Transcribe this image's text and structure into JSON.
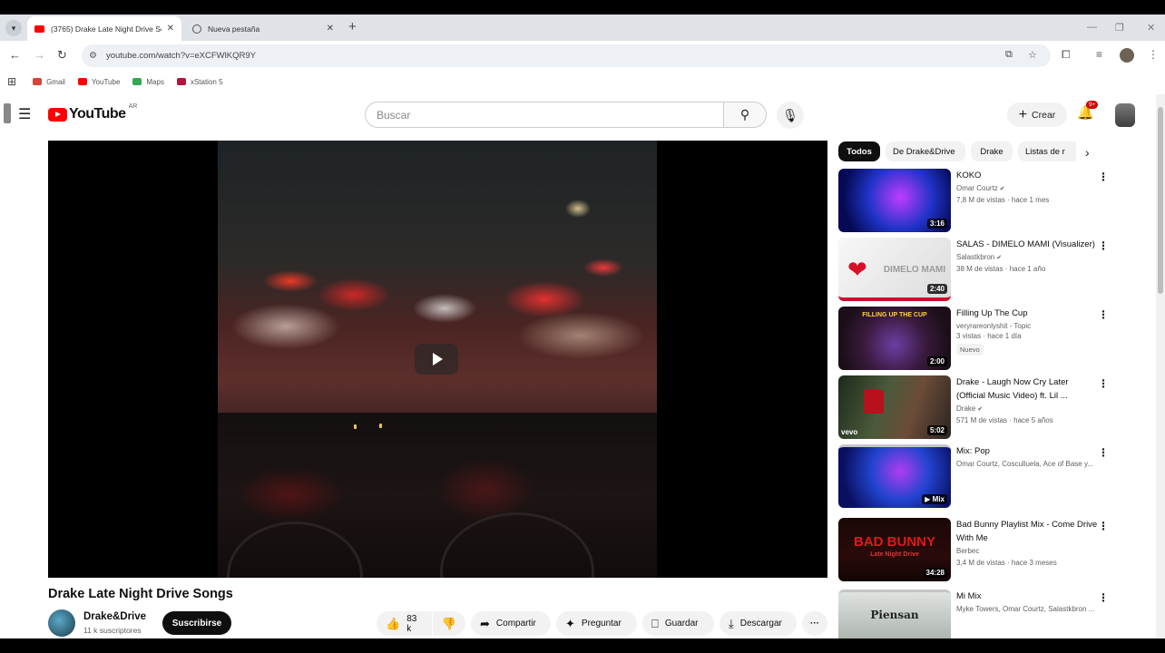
{
  "browser": {
    "tabs": [
      {
        "title": "(3765) Drake Late Night Drive Son",
        "active": true
      },
      {
        "title": "Nueva pestaña",
        "active": false
      }
    ],
    "url": "youtube.com/watch?v=eXCFWlKQR9Y",
    "bookmarks": [
      "Gmail",
      "YouTube",
      "Maps",
      "xStation 5"
    ]
  },
  "header": {
    "logo_text": "YouTube",
    "logo_country": "AR",
    "search_placeholder": "Buscar",
    "create_label": "Crear",
    "notif_badge": "9+"
  },
  "video": {
    "title": "Drake Late Night Drive Songs",
    "channel": "Drake&Drive",
    "subscribers": "11 k suscriptores",
    "subscribe_label": "Suscribirse",
    "likes": "83 k",
    "actions": {
      "share": "Compartir",
      "ask": "Preguntar",
      "save": "Guardar",
      "download": "Descargar"
    }
  },
  "sidebar": {
    "chips": [
      "Todos",
      "De Drake&Drive",
      "Drake",
      "Listas de r"
    ],
    "recommendations": [
      {
        "title": "KOKO",
        "channel": "Omar Courtz",
        "verified": true,
        "meta": "7,8 M de vistas · hace 1 mes",
        "duration": "3:16",
        "badge": ""
      },
      {
        "title": "SALAS - DIMELO MAMI (Visualizer)",
        "channel": "Salastkbron",
        "verified": true,
        "meta": "38 M de vistas · hace 1 año",
        "duration": "2:40",
        "badge": ""
      },
      {
        "title": "Filling Up The Cup",
        "channel": "veryrareonlyshit - Topic",
        "verified": false,
        "meta": "3 vistas · hace 1 día",
        "duration": "2:00",
        "badge": "Nuevo"
      },
      {
        "title": "Drake - Laugh Now Cry Later (Official Music Video) ft. Lil ...",
        "channel": "Drake",
        "verified": true,
        "meta": "571 M de vistas · hace 5 años",
        "duration": "5:02",
        "badge": ""
      },
      {
        "title": "Mix: Pop",
        "channel": "Omar Courtz, Cosculluela, Ace of Base y...",
        "verified": false,
        "meta": "",
        "duration": "Mix",
        "badge": ""
      },
      {
        "title": "Bad Bunny Playlist Mix - Come Drive With Me",
        "channel": "Berbec",
        "verified": false,
        "meta": "3,4 M de vistas · hace 3 meses",
        "duration": "34:28",
        "badge": ""
      },
      {
        "title": "Mi Mix",
        "channel": "Myke Towers, Omar Courtz, Salastkbron ...",
        "verified": false,
        "meta": "",
        "duration": "",
        "badge": ""
      }
    ],
    "thumb_texts": {
      "dimelo": "DIMELO MAMI",
      "filling": "FILLING UP THE CUP",
      "badbunny": "BAD BUNNY",
      "badbunny_sub": "Late Night Drive",
      "vevo": "vevo",
      "piensan": "Piensan"
    }
  }
}
